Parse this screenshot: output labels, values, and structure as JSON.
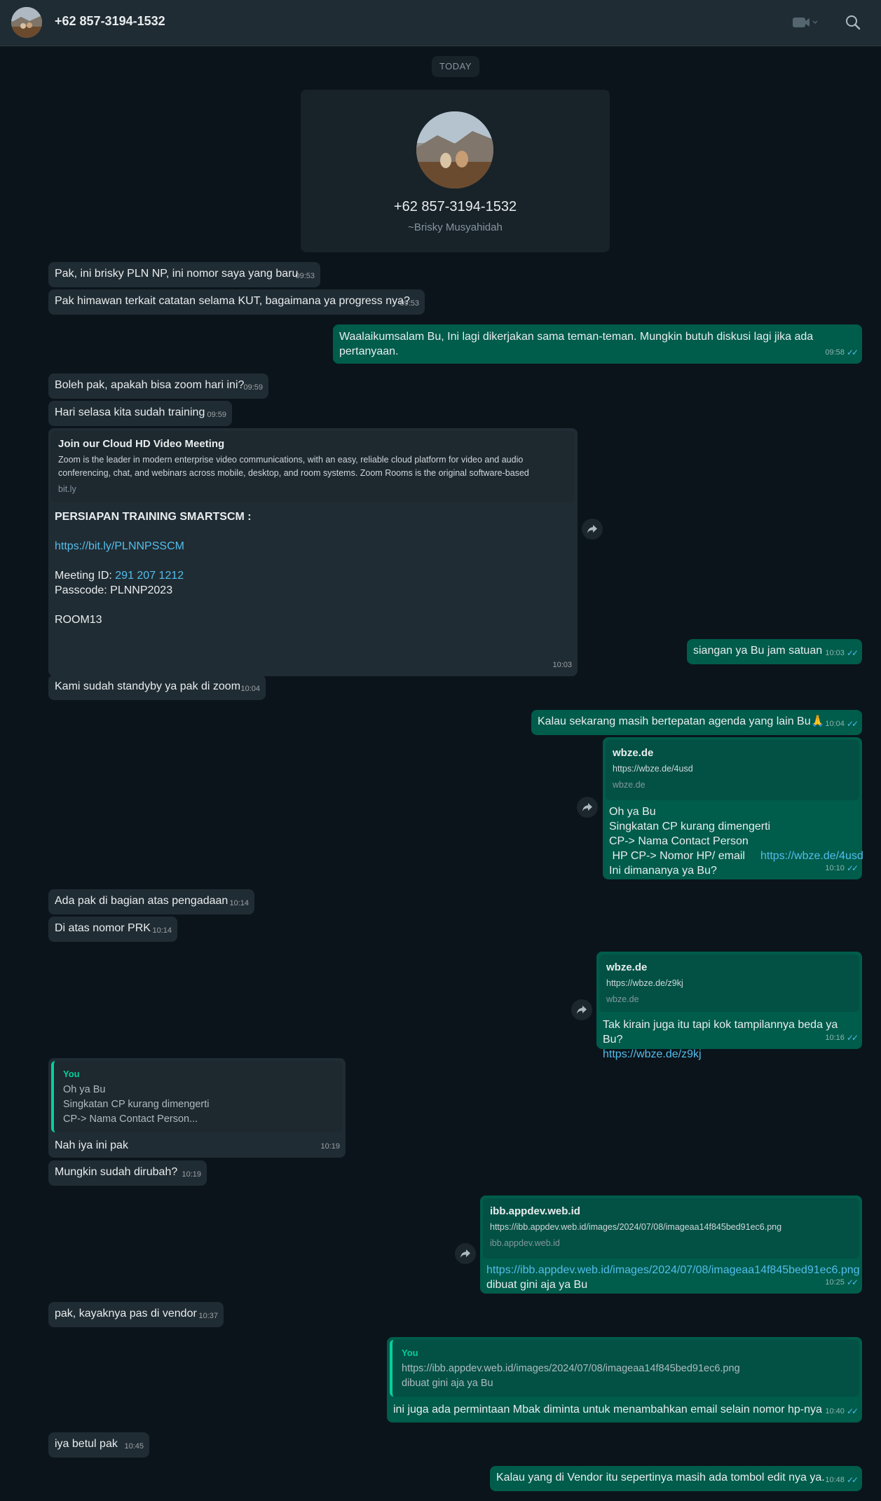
{
  "header": {
    "title": "+62 857-3194-1532"
  },
  "date_chip": "TODAY",
  "contact_card": {
    "phone": "+62 857-3194-1532",
    "alias": "~Brisky Musyahidah"
  },
  "messages": {
    "m1": {
      "text": "Pak, ini brisky PLN NP, ini nomor saya yang baru",
      "time": "09:53"
    },
    "m2": {
      "text": "Pak himawan terkait catatan selama KUT, bagaimana ya progress nya?",
      "time": "09:53"
    },
    "m3": {
      "text": "Waalaikumsalam Bu, Ini lagi dikerjakan sama teman-teman. Mungkin butuh diskusi lagi jika ada pertanyaan.",
      "time": "09:58"
    },
    "m4": {
      "text": "Boleh pak, apakah bisa zoom hari ini?",
      "time": "09:59"
    },
    "m5": {
      "text": "Hari selasa kita sudah training",
      "time": "09:59"
    },
    "m6": {
      "preview_title": "Join our Cloud HD Video Meeting",
      "preview_desc": "Zoom is the leader in modern enterprise video communications, with an easy, reliable cloud platform for video and audio conferencing, chat, and webinars across mobile, desktop, and room systems. Zoom Rooms is the original software-based",
      "preview_domain": "bit.ly",
      "heading": "PERSIAPAN TRAINING SMARTSCM :",
      "link": "https://bit.ly/PLNNPSSCM",
      "meeting_label": "Meeting ID: ",
      "meeting_id": "291 207 1212",
      "passcode": "Passcode: PLNNP2023",
      "room": "ROOM13",
      "time": "10:03"
    },
    "m7": {
      "text": "siangan ya Bu jam satuan",
      "time": "10:03"
    },
    "m8": {
      "text": "Kami sudah standyby ya pak di zoom",
      "time": "10:04"
    },
    "m9": {
      "text": "Kalau sekarang masih bertepatan agenda yang lain Bu🙏",
      "time": "10:04"
    },
    "m10": {
      "preview_title": "wbze.de",
      "preview_desc": "https://wbze.de/4usd",
      "preview_domain": "wbze.de",
      "line1": "Oh ya Bu",
      "line2": "Singkatan CP kurang dimengerti",
      "line3": "CP-> Nama Contact Person",
      "line4": " HP CP-> Nomor HP/ email",
      "link": "https://wbze.de/4usd",
      "line5": "Ini dimananya ya Bu?",
      "time": "10:10"
    },
    "m11": {
      "text": "Ada pak di bagian atas pengadaan",
      "time": "10:14"
    },
    "m12": {
      "text": "Di atas nomor PRK",
      "time": "10:14"
    },
    "m13": {
      "preview_title": "wbze.de",
      "preview_desc": "https://wbze.de/z9kj",
      "preview_domain": "wbze.de",
      "text": "Tak kirain juga itu tapi kok tampilannya beda ya Bu?",
      "link": "https://wbze.de/z9kj",
      "time": "10:16"
    },
    "m14": {
      "quote_name": "You",
      "quote_line1": "Oh ya Bu",
      "quote_line2": "Singkatan CP kurang dimengerti",
      "quote_line3": "CP-> Nama Contact Person...",
      "text": "Nah iya ini pak",
      "time": "10:19"
    },
    "m15": {
      "text": "Mungkin sudah dirubah?",
      "time": "10:19"
    },
    "m16": {
      "preview_title": "ibb.appdev.web.id",
      "preview_desc": "https://ibb.appdev.web.id/images/2024/07/08/imageaa14f845bed91ec6.png",
      "preview_domain": "ibb.appdev.web.id",
      "link": "https://ibb.appdev.web.id/images/2024/07/08/imageaa14f845bed91ec6.png",
      "text": "dibuat gini aja ya Bu",
      "time": "10:25"
    },
    "m17": {
      "text": "pak, kayaknya pas di vendor",
      "time": "10:37"
    },
    "m18": {
      "quote_name": "You",
      "quote_line1": "https://ibb.appdev.web.id/images/2024/07/08/imageaa14f845bed91ec6.png",
      "quote_line2": "dibuat gini aja ya Bu",
      "text": "ini juga ada permintaan Mbak diminta untuk menambahkan email selain nomor hp-nya",
      "time": "10:40"
    },
    "m19": {
      "text": "iya betul pak",
      "time": "10:45"
    },
    "m20": {
      "text": "Kalau yang di Vendor itu sepertinya masih ada tombol edit nya ya.",
      "time": "10:48"
    }
  },
  "ticks": "✓✓",
  "icons": [
    "video-call-icon",
    "chevron-down-icon",
    "search-icon",
    "forward-icon"
  ],
  "colors": {
    "background": "#0b141a",
    "header": "#202c33",
    "incoming_bubble": "#202c33",
    "outgoing_bubble": "#005c4b",
    "link": "#53bdeb",
    "read_ticks": "#53bdeb",
    "quote_accent": "#06cf9c"
  }
}
